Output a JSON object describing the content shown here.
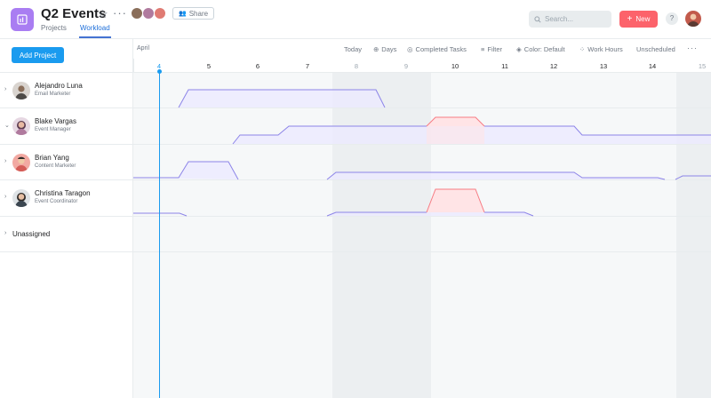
{
  "header": {
    "title": "Q2 Events",
    "share_label": "Share",
    "tabs": [
      {
        "label": "Projects"
      },
      {
        "label": "Workload"
      }
    ],
    "search_placeholder": "Search...",
    "new_label": "New",
    "help_label": "?"
  },
  "sidebar": {
    "add_project_label": "Add Project",
    "rows": [
      {
        "name": "Alejandro Luna",
        "role": "Email Marketer",
        "avatar_color": "#8a6e5a"
      },
      {
        "name": "Blake Vargas",
        "role": "Event Manager",
        "avatar_color": "#b07a9e"
      },
      {
        "name": "Brian Yang",
        "role": "Content Marketer",
        "avatar_color": "#e07b73"
      },
      {
        "name": "Christina Taragon",
        "role": "Event Coordinator",
        "avatar_color": "#7a8a96"
      }
    ],
    "unassigned_label": "Unassigned"
  },
  "toolbar": {
    "month": "April",
    "today": "Today",
    "days": "Days",
    "completed": "Completed Tasks",
    "filter": "Filter",
    "color": "Color: Default",
    "work_hours": "Work Hours",
    "unscheduled": "Unscheduled"
  },
  "days": [
    "4",
    "5",
    "6",
    "7",
    "8",
    "9",
    "10",
    "11",
    "12",
    "13",
    "14",
    "15"
  ],
  "colors": {
    "accent": "#1a9bef",
    "load_line": "#8c84e8",
    "load_fill": "#eceaff",
    "over_line": "#f77b83",
    "over_fill": "#ffe4e6",
    "new_button": "#fc636b",
    "project_icon": "#a97df2"
  }
}
